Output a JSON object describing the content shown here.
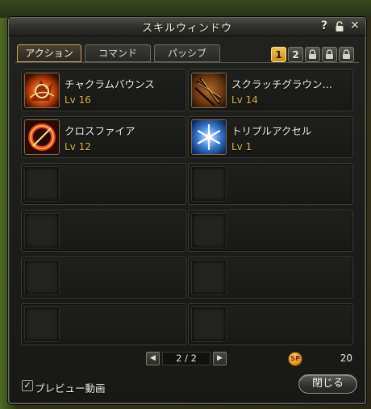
{
  "window": {
    "title": "スキルウィンドウ",
    "help_label": "?",
    "close_label": "✕"
  },
  "tabs": [
    {
      "label": "アクション",
      "active": true
    },
    {
      "label": "コマンド",
      "active": false
    },
    {
      "label": "パッシブ",
      "active": false
    }
  ],
  "set_pages": [
    {
      "label": "1",
      "state": "active"
    },
    {
      "label": "2",
      "state": "normal"
    },
    {
      "label": "",
      "state": "locked"
    },
    {
      "label": "",
      "state": "locked"
    },
    {
      "label": "",
      "state": "locked"
    }
  ],
  "skills": [
    {
      "name": "チャクラムバウンス",
      "level": "Lv 16",
      "icon": "chakram-bounce-icon"
    },
    {
      "name": "スクラッチグラウン…",
      "level": "Lv 14",
      "icon": "scratch-ground-icon"
    },
    {
      "name": "クロスファイア",
      "level": "Lv 12",
      "icon": "crossfire-icon"
    },
    {
      "name": "トリプルアクセル",
      "level": "Lv 1",
      "icon": "triple-axel-icon"
    }
  ],
  "pager": {
    "text": "2 / 2",
    "prev": "◀",
    "next": "▶"
  },
  "sp": {
    "icon_label": "SP",
    "value": "20"
  },
  "preview": {
    "checked": true,
    "check_mark": "✓",
    "label": "プレビュー動画"
  },
  "close_button": {
    "label": "閉じる"
  }
}
